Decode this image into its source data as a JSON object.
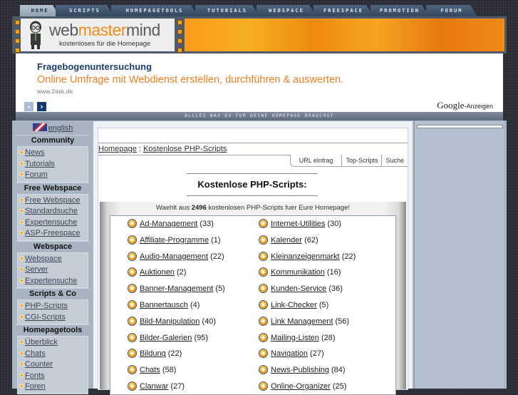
{
  "nav": {
    "tabs": [
      {
        "label": "Home",
        "active": true
      },
      {
        "label": "Scripts",
        "active": false
      },
      {
        "label": "Homepagetools",
        "active": false
      },
      {
        "label": "Tutorials",
        "active": false
      },
      {
        "label": "Webspace",
        "active": false
      },
      {
        "label": "Freespace",
        "active": false
      },
      {
        "label": "Promotion",
        "active": false
      },
      {
        "label": "Forum",
        "active": false
      }
    ]
  },
  "header": {
    "brand_prefix": "web",
    "brand_middle": "master",
    "brand_suffix": "mind",
    "tagline": "kostenloses für die Homepage",
    "colors": {
      "accent": "#f08c1c",
      "banner": "#f6a422"
    }
  },
  "ad": {
    "title": "Fragebogenuntersuchung",
    "text": "Online Umfrage mit Webdienst erstellen, durchführen & auswerten.",
    "url": "www.2ask.de",
    "prev_icon": "chevron-left-icon",
    "next_icon": "chevron-right-icon",
    "google_label": "Google",
    "google_suffix": "-Anzeigen"
  },
  "strip": {
    "text": "Allles was du fur deine Homepage brauchst"
  },
  "sidebar": {
    "language_link": "english",
    "sections": [
      {
        "title": "Community",
        "items": [
          "News",
          "Tutorials",
          "Forum"
        ]
      },
      {
        "title": "Free Webspace",
        "items": [
          "Free Webspace",
          "Standardsuche",
          "Expertensuche",
          "ASP-Freespace"
        ]
      },
      {
        "title": "Webspace",
        "items": [
          "Webspace",
          "Server",
          "Expertensuche"
        ]
      },
      {
        "title": "Scripts & Co",
        "items": [
          "PHP-Scripts",
          "CGI-Scripts"
        ]
      },
      {
        "title": "Homepagetools",
        "items": [
          "Überblick",
          "Chats",
          "Counter",
          "Fonts",
          "Foren"
        ]
      }
    ]
  },
  "main": {
    "breadcrumb": {
      "home": "Homepage",
      "separator": " : ",
      "current": "Kostenlose PHP-Scripts"
    },
    "tools": [
      "URL eintrag",
      "Top-Scripts",
      "Suche"
    ],
    "title": "Kostenlose PHP-Scripts:",
    "intro_prefix": "Waehlt aus ",
    "intro_count": "2496",
    "intro_suffix": " kostenlosen PHP-Scripts fuer Eure Homepage!",
    "categories_left": [
      {
        "name": "Ad-Management",
        "count": "(33)"
      },
      {
        "name": "Affiliate-Programme",
        "count": "(1)"
      },
      {
        "name": "Audio-Management",
        "count": "(22)"
      },
      {
        "name": "Auktionen",
        "count": "(2)"
      },
      {
        "name": "Banner-Management",
        "count": "(5)"
      },
      {
        "name": "Bannertausch",
        "count": "(4)"
      },
      {
        "name": "Bild-Manipulation",
        "count": "(40)"
      },
      {
        "name": "Bilder-Galerien",
        "count": "(95)"
      },
      {
        "name": "Bildung",
        "count": "(22)"
      },
      {
        "name": "Chats",
        "count": "(58)"
      },
      {
        "name": "Clanwar",
        "count": "(27)"
      }
    ],
    "categories_right": [
      {
        "name": "Internet-Utilities",
        "count": "(30)"
      },
      {
        "name": "Kalender",
        "count": "(62)"
      },
      {
        "name": "Kleinanzeigenmarkt",
        "count": "(22)"
      },
      {
        "name": "Kommunikation",
        "count": "(16)"
      },
      {
        "name": "Kunden-Service",
        "count": "(36)"
      },
      {
        "name": "Link-Checker",
        "count": "(5)"
      },
      {
        "name": "Link Management",
        "count": "(56)"
      },
      {
        "name": "Mailing-Listen",
        "count": "(28)"
      },
      {
        "name": "Navigation",
        "count": "(27)"
      },
      {
        "name": "News-Publishing",
        "count": "(84)"
      },
      {
        "name": "Online-Organizer",
        "count": "(25)"
      }
    ]
  }
}
